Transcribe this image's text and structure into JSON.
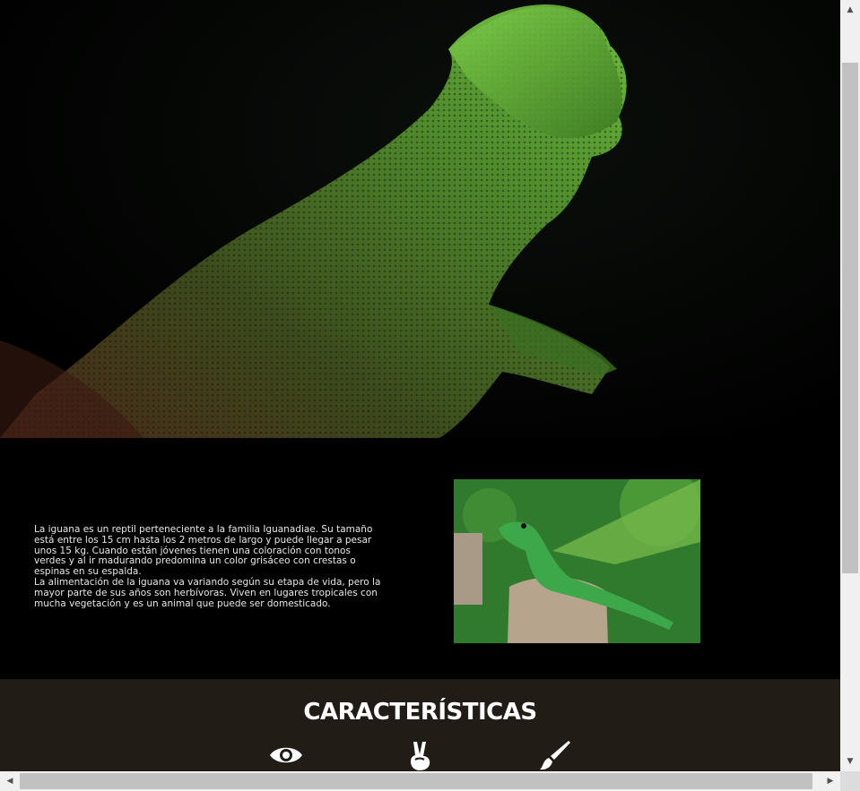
{
  "intro": {
    "paragraph1": "La iguana es un reptil perteneciente a la familia Iguanadiae. Su tamaño está entre los 15 cm hasta los 2 metros de largo y puede llegar a pesar unos 15 kg. Cuando están jóvenes tienen una coloración con tonos verdes y al ir madurando predomina un color grisáceo con crestas o espinas en su espalda.",
    "paragraph2": "La alimentación de la iguana va variando según su etapa de vida, pero la mayor parte de sus años son herbívoras. Viven en lugares tropicales con mucha vegetación y es un animal que puede ser domesticado."
  },
  "features": {
    "title": "CARACTERÍSTICAS",
    "icons": [
      "eye-icon",
      "peace-hand-icon",
      "paintbrush-icon"
    ]
  },
  "colors": {
    "page_bg": "#000000",
    "features_bg": "#221c17",
    "lizard_green": "#5aa83a"
  }
}
